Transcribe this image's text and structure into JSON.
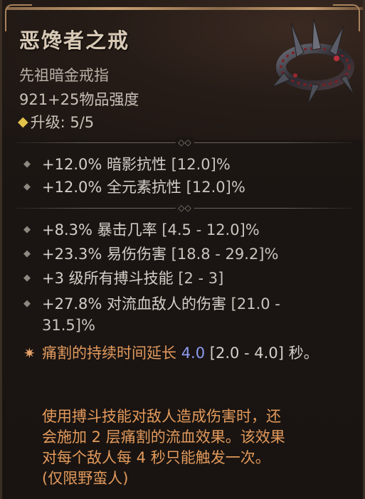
{
  "item": {
    "name": "恶馋者之戒",
    "type": "先祖暗金戒指",
    "power": "921+25物品强度",
    "upgrade": "升级: 5/5"
  },
  "implicits": [
    {
      "value": "+12.0% 暗影抗性",
      "range": "[12.0]%"
    },
    {
      "value": "+12.0% 全元素抗性",
      "range": "[12.0]%"
    }
  ],
  "affixes": [
    {
      "value": "+8.3% 暴击几率",
      "range": "[4.5 - 12.0]%"
    },
    {
      "value": "+23.3% 易伤伤害",
      "range": "[18.8 - 29.2]%"
    },
    {
      "value": "+3 级所有搏斗技能",
      "range": "[2 - 3]"
    },
    {
      "value": "+27.8% 对流血敌人的伤害",
      "range": "[21.0 - 31.5]%"
    }
  ],
  "legendary": {
    "skill": "痛割",
    "text": "的持续时间延长",
    "value": "4.0",
    "range": "[2.0 - 4.0]",
    "unit": "秒。"
  },
  "unique_description": {
    "line1": "使用搏斗技能对敌人造成伤害时，还",
    "line2": "会施加 2 层痛割的流血效果。该效果",
    "line3": "对每个敌人每 4 秒只能触发一次。",
    "line4": "(仅限野蛮人)"
  },
  "icons": {
    "upgrade": "gold-diamond-icon",
    "affix_bullet": "diamond-bullet-icon",
    "legendary": "unique-star-icon",
    "ring": "ring-icon"
  },
  "colors": {
    "unique_orange": "#e29a5e",
    "value_blue": "#8e9cf2",
    "upgrade_gold": "#e3c24a"
  }
}
